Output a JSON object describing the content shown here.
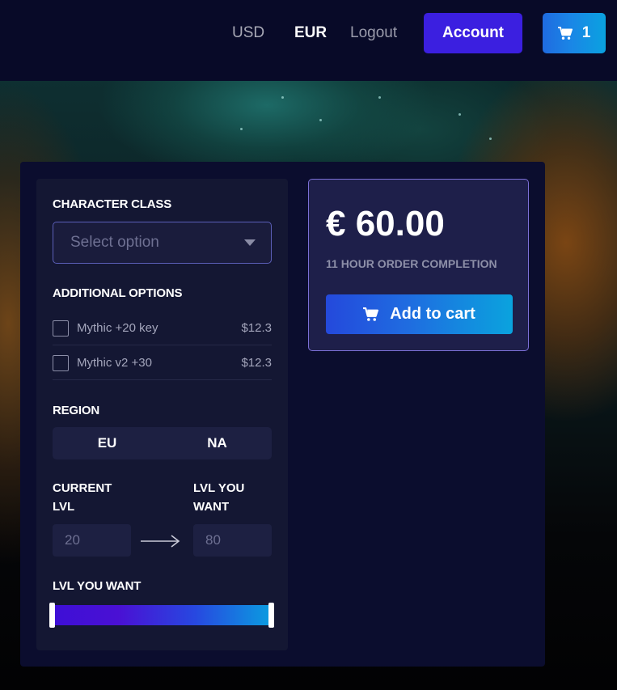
{
  "nav": {
    "currency_usd": "USD",
    "currency_eur": "EUR",
    "logout": "Logout",
    "account": "Account",
    "cart_count": "1",
    "cart_icon": "cart-icon"
  },
  "form": {
    "character_class": {
      "title": "CHARACTER CLASS",
      "placeholder": "Select option"
    },
    "additional_options": {
      "title": "ADDITIONAL OPTIONS",
      "items": [
        {
          "label": "Mythic +20 key",
          "price": "$12.3",
          "checked": false
        },
        {
          "label": "Mythic v2 +30",
          "price": "$12.3",
          "checked": false
        }
      ]
    },
    "region": {
      "title": "REGION",
      "options": [
        "EU",
        "NA"
      ]
    },
    "levels": {
      "current_label_line1": "CURRENT",
      "current_label_line2": "LVL",
      "want_label_line1": "LVL YOU",
      "want_label_line2": "WANT",
      "current_value": "20",
      "want_value": "80"
    },
    "slider": {
      "title": "LVL YOU WANT",
      "range_start_fraction": 0.0,
      "range_end_fraction": 1.0
    }
  },
  "price_card": {
    "amount": "€ 60.00",
    "completion": "11 HOUR ORDER COMPLETION",
    "add_to_cart": "Add to cart"
  },
  "colors": {
    "accent": "#3b1fe0",
    "gradient_start": "#2449dc",
    "gradient_end": "#0aa3de",
    "panel": "#0b0d2e"
  }
}
